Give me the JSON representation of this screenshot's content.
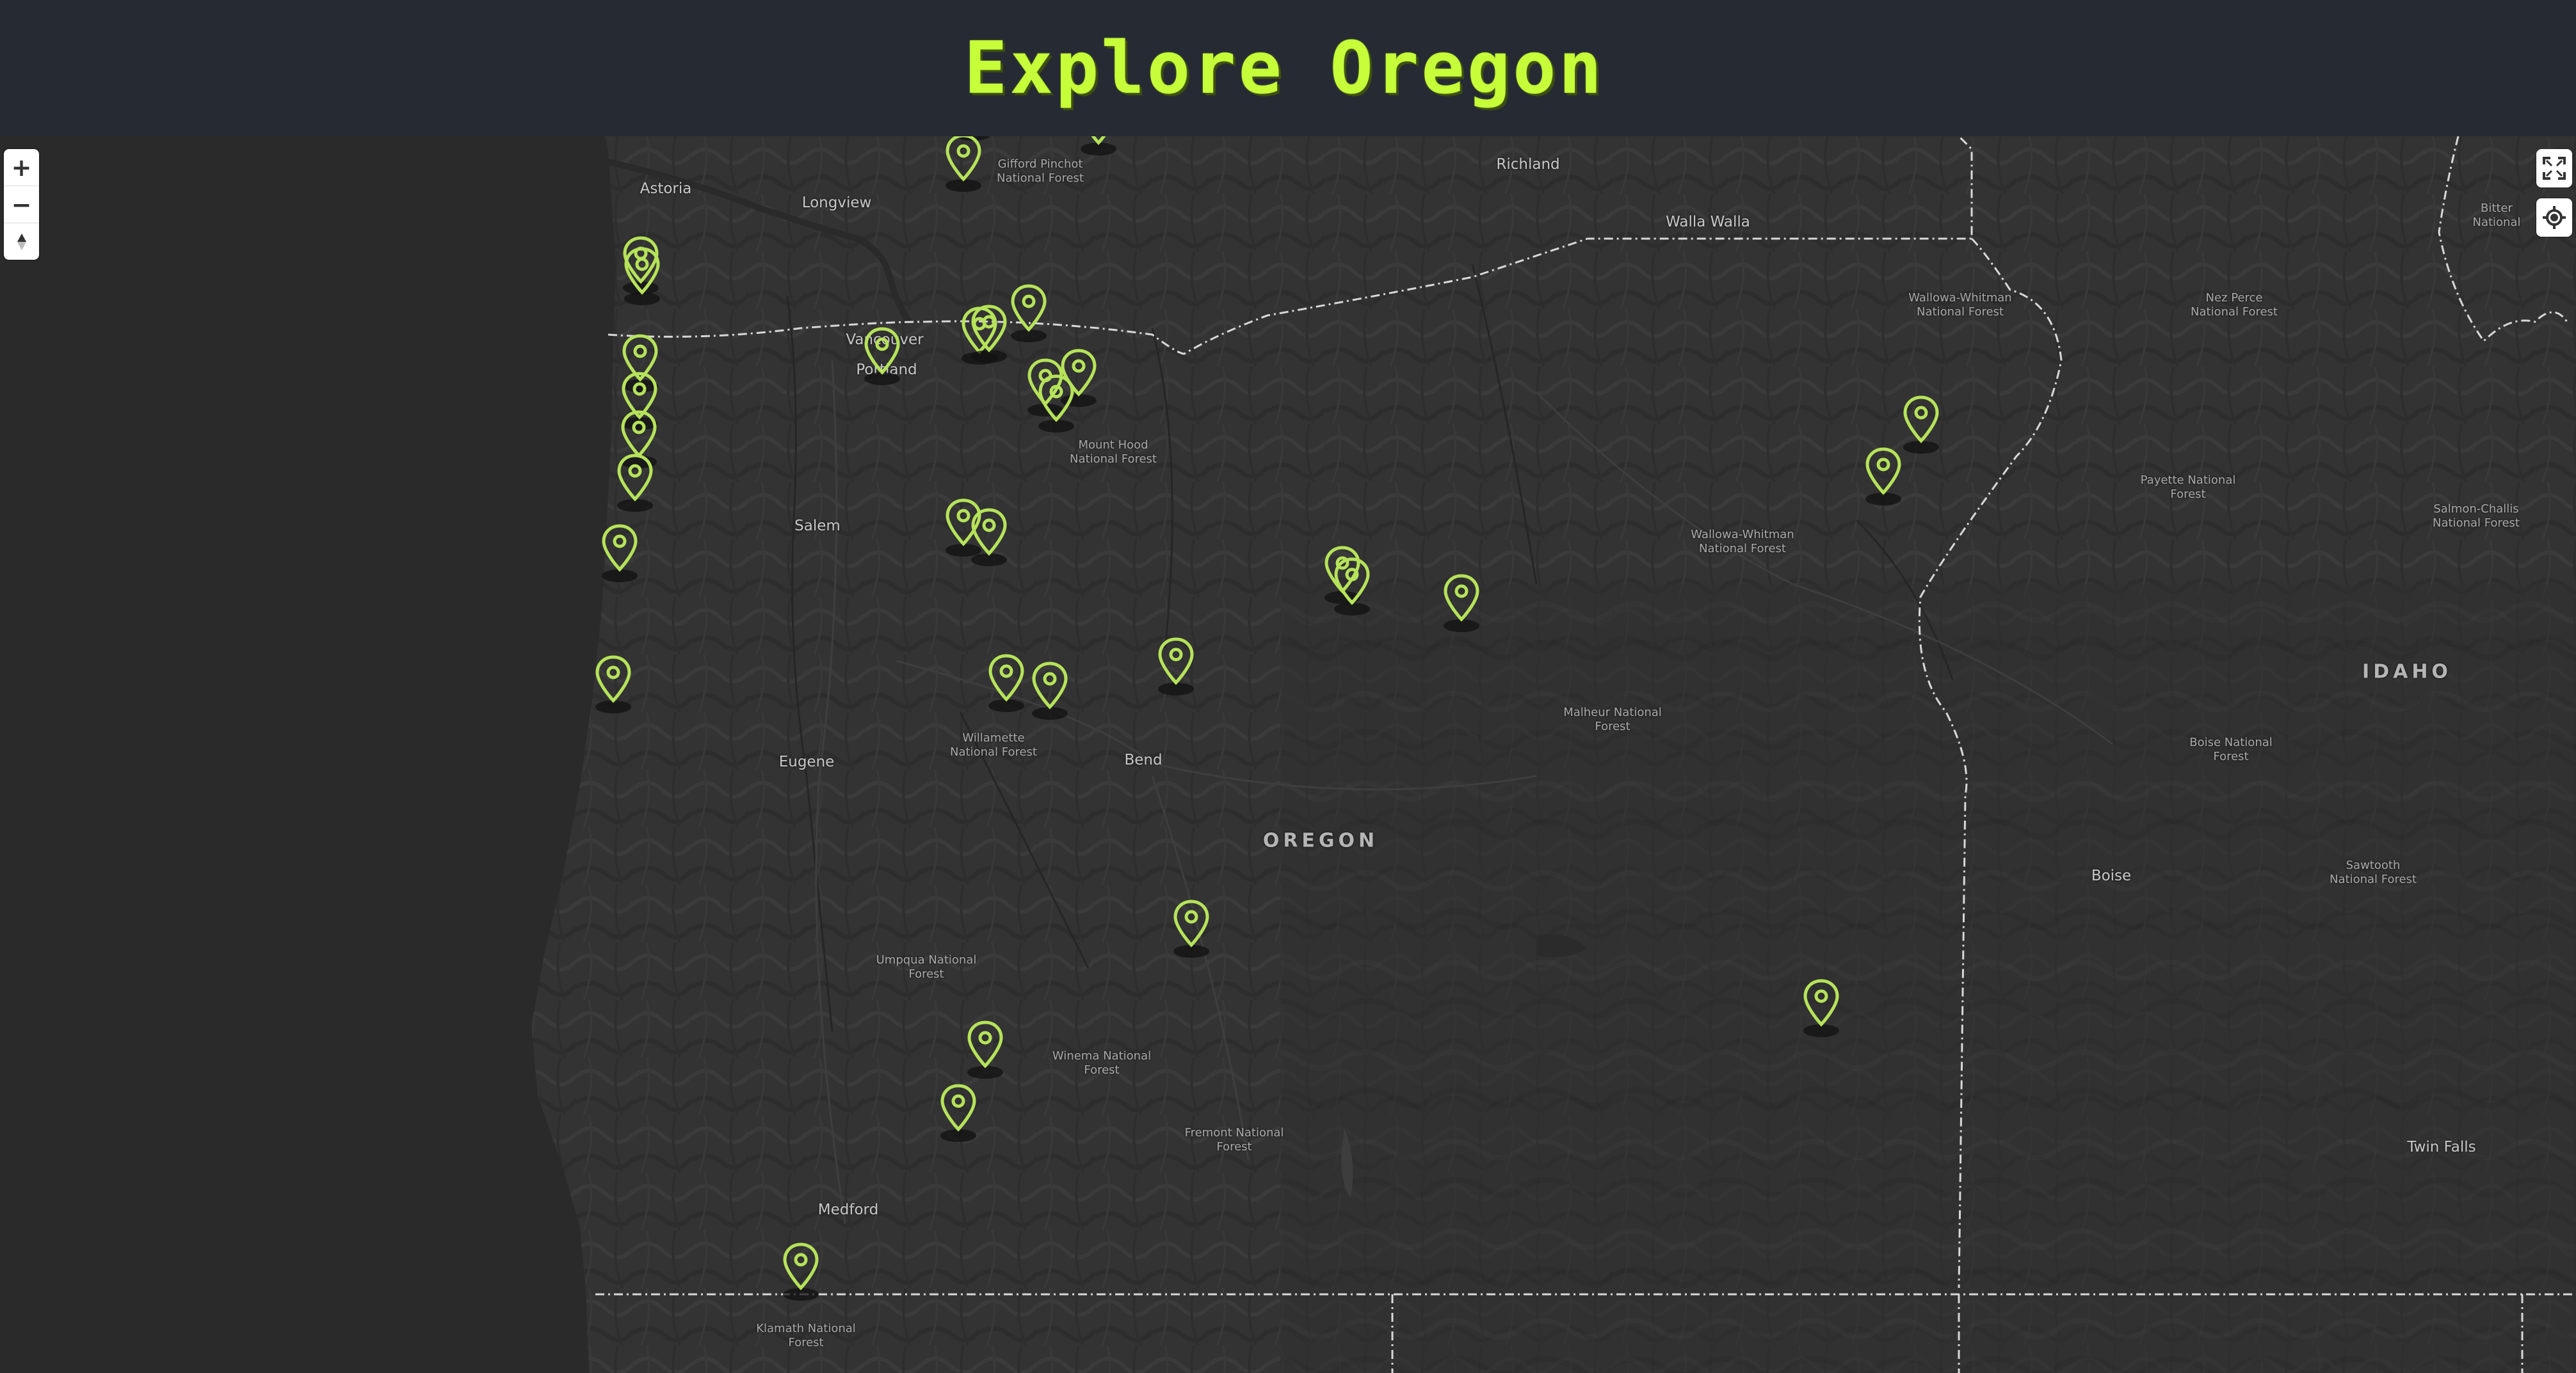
{
  "header": {
    "title": "Explore Oregon"
  },
  "controls": {
    "zoom_in": "+",
    "zoom_out": "−",
    "compass": "▲",
    "fullscreen_icon": "fullscreen-icon",
    "geolocate_icon": "geolocate-icon"
  },
  "colors": {
    "accent": "#c6ff3a",
    "marker": "#b6e35a",
    "header_bg": "#262a33",
    "map_bg": "#2a2a2a"
  },
  "map_labels": [
    {
      "text": "Astoria",
      "class": "city"
    },
    {
      "text": "Longview",
      "class": "city"
    },
    {
      "text": "Gifford Pinchot National Forest",
      "class": "small"
    },
    {
      "text": "Richland",
      "class": "city"
    },
    {
      "text": "Walla Walla",
      "class": "city"
    },
    {
      "text": "Vancouver",
      "class": "city"
    },
    {
      "text": "Portland",
      "class": "city"
    },
    {
      "text": "Mount Hood National Forest",
      "class": "small"
    },
    {
      "text": "Salem",
      "class": "city"
    },
    {
      "text": "Wallowa-Whitman National Forest",
      "class": "small"
    },
    {
      "text": "Nez Perce National Forest",
      "class": "small"
    },
    {
      "text": "Payette National Forest",
      "class": "small"
    },
    {
      "text": "Salmon-Challis National Forest",
      "class": "small"
    },
    {
      "text": "Bitter National",
      "class": "small"
    },
    {
      "text": "Wallowa-Whitman National Forest",
      "class": "small"
    },
    {
      "text": "IDAHO",
      "class": "state"
    },
    {
      "text": "Malheur National Forest",
      "class": "small"
    },
    {
      "text": "Boise National Forest",
      "class": "small"
    },
    {
      "text": "Eugene",
      "class": "city"
    },
    {
      "text": "Willamette National Forest",
      "class": "small"
    },
    {
      "text": "Bend",
      "class": "city"
    },
    {
      "text": "OREGON",
      "class": "state"
    },
    {
      "text": "Boise",
      "class": "city"
    },
    {
      "text": "Sawtooth National Forest",
      "class": "small"
    },
    {
      "text": "Umpqua National Forest",
      "class": "small"
    },
    {
      "text": "Winema National Forest",
      "class": "small"
    },
    {
      "text": "Fremont National Forest",
      "class": "small"
    },
    {
      "text": "Twin Falls",
      "class": "city"
    },
    {
      "text": "Medford",
      "class": "city"
    },
    {
      "text": "Klamath National Forest",
      "class": "small"
    }
  ]
}
